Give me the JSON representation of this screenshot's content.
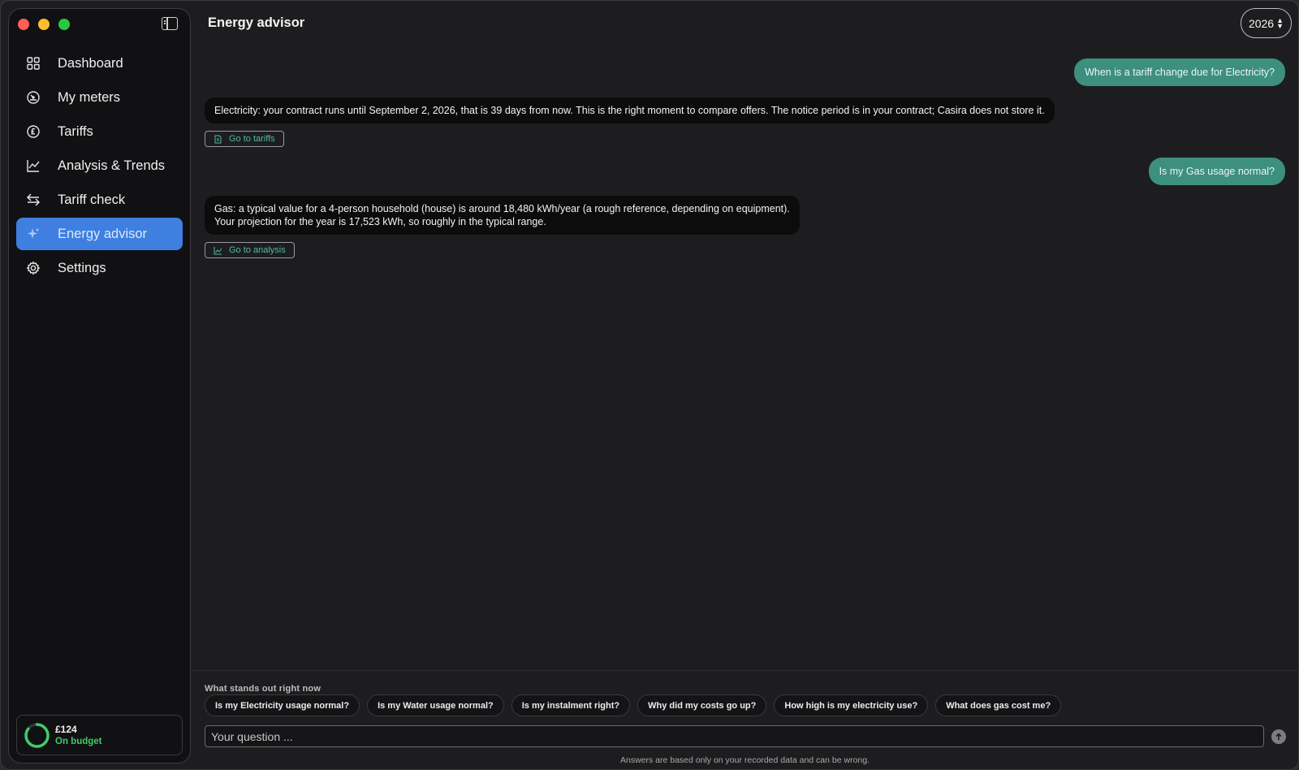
{
  "window": {
    "traffic_lights": [
      "close",
      "minimize",
      "zoom"
    ]
  },
  "sidebar": {
    "items": [
      {
        "label": "Dashboard",
        "icon": "grid-icon",
        "active": false
      },
      {
        "label": "My meters",
        "icon": "gauge-icon",
        "active": false
      },
      {
        "label": "Tariffs",
        "icon": "pound-coin-icon",
        "active": false
      },
      {
        "label": "Analysis & Trends",
        "icon": "line-chart-icon",
        "active": false
      },
      {
        "label": "Tariff check",
        "icon": "swap-arrows-icon",
        "active": false
      },
      {
        "label": "Energy advisor",
        "icon": "sparkle-icon",
        "active": true
      },
      {
        "label": "Settings",
        "icon": "gear-icon",
        "active": false
      }
    ],
    "budget": {
      "amount": "£124",
      "status": "On budget",
      "progress": 0.85,
      "color": "#3ecb6a"
    }
  },
  "header": {
    "title": "Energy advisor",
    "year": "2026"
  },
  "chat": {
    "messages": [
      {
        "role": "user",
        "text": "When is a tariff change due for Electricity?"
      },
      {
        "role": "assistant",
        "lines": [
          "Electricity: your contract runs until September 2, 2026, that is 39 days from now. This is the right moment to compare offers. The notice period is in your contract; Casira does not store it."
        ],
        "action": "Go to tariffs",
        "action_icon": "document-icon"
      },
      {
        "role": "user",
        "text": "Is my Gas usage normal?"
      },
      {
        "role": "assistant",
        "lines": [
          "Gas: a typical value for a 4-person household (house) is around 18,480 kWh/year (a rough reference, depending on equipment).",
          "Your projection for the year is 17,523 kWh, so roughly in the typical range."
        ],
        "action": "Go to analysis",
        "action_icon": "line-chart-icon"
      }
    ]
  },
  "suggestions": {
    "title": "What stands out right now",
    "chips": [
      "Is my Electricity usage normal?",
      "Is my Water usage normal?",
      "Is my instalment right?",
      "Why did my costs go up?",
      "How high is my electricity use?",
      "What does gas cost me?"
    ]
  },
  "composer": {
    "placeholder": "Your question ...",
    "send_icon": "arrow-up-icon"
  },
  "disclaimer": "Answers are based only on your recorded data and can be wrong.",
  "colors": {
    "accent": "#3f7fdf",
    "user_bubble": "#3d8f7e",
    "link": "#4fb9a2"
  }
}
